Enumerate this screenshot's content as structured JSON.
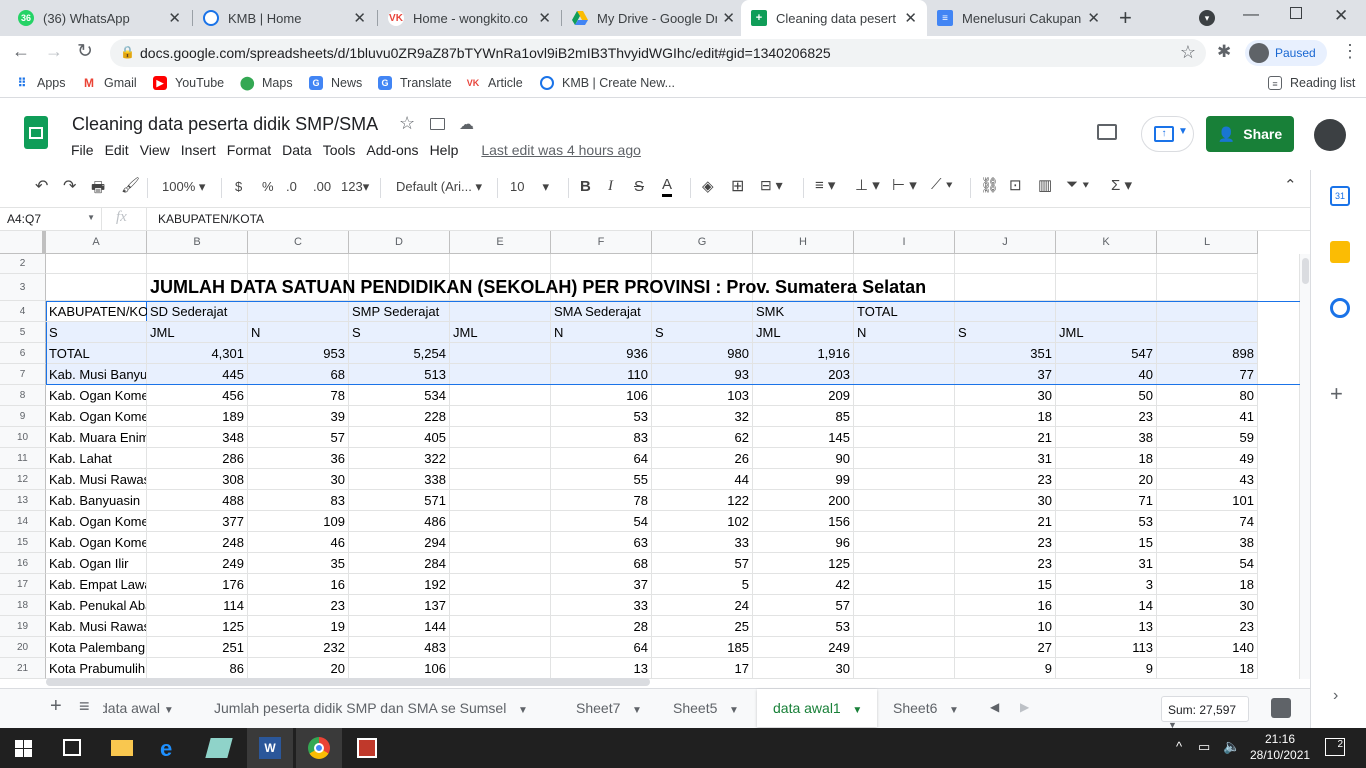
{
  "browser": {
    "tabs": [
      {
        "title": "(36) WhatsApp",
        "badge": "36",
        "color": "#25d366"
      },
      {
        "title": "KMB | Home",
        "color": "#1a73e8"
      },
      {
        "title": "Home - wongkito.co",
        "color": "#e8453c"
      },
      {
        "title": "My Drive - Google Dri",
        "color": "#fbbc04"
      },
      {
        "title": "Cleaning data peserta",
        "color": "#0f9d58"
      },
      {
        "title": "Menelusuri Cakupan V",
        "color": "#4285f4"
      }
    ],
    "url": "docs.google.com/spreadsheets/d/1bluvu0ZR9aZ87bTYWnRa1ovl9iB2mIB3ThvyidWGIhc/edit#gid=1340206825",
    "profile_label": "Paused",
    "bookmarks": [
      "Apps",
      "Gmail",
      "YouTube",
      "Maps",
      "News",
      "Translate",
      "Article",
      "KMB | Create New..."
    ],
    "reading_list": "Reading list"
  },
  "doc": {
    "title": "Cleaning data peserta didik SMP/SMA",
    "menus": [
      "File",
      "Edit",
      "View",
      "Insert",
      "Format",
      "Data",
      "Tools",
      "Add-ons",
      "Help"
    ],
    "last_edit": "Last edit was 4 hours ago",
    "share_label": "Share"
  },
  "toolbar": {
    "zoom": "100%",
    "currency": "$",
    "percent": "%",
    "dec_less": ".0",
    "dec_more": ".00",
    "format_more": "123",
    "font": "Default (Ari...",
    "font_size": "10"
  },
  "formula": {
    "namebox": "A4:Q7",
    "fx": "fx",
    "content": "KABUPATEN/KOTA"
  },
  "grid": {
    "columns": [
      "A",
      "B",
      "C",
      "D",
      "E",
      "F",
      "G",
      "H",
      "I",
      "J",
      "K",
      "L"
    ],
    "rownums": [
      "2",
      "3",
      "4",
      "5",
      "6",
      "7",
      "8",
      "9",
      "10",
      "11",
      "12",
      "13",
      "14",
      "15",
      "16",
      "17",
      "18",
      "19",
      "20",
      "21"
    ],
    "title": "JUMLAH DATA SATUAN PENDIDIKAN (SEKOLAH) PER PROVINSI : Prov. Sumatera Selatan",
    "row4": [
      "KABUPATEN/KOTA",
      "SD Sederajat",
      "",
      "SMP Sederajat",
      "",
      "SMA Sederajat",
      "",
      "SMK",
      "TOTAL",
      "",
      "",
      ""
    ],
    "row5": [
      "S",
      "JML",
      "N",
      "S",
      "JML",
      "N",
      "S",
      "JML",
      "N",
      "S",
      "JML",
      ""
    ],
    "data": [
      [
        "TOTAL",
        "4,301",
        "953",
        "5,254",
        "",
        "936",
        "980",
        "1,916",
        "",
        "351",
        "547",
        "898"
      ],
      [
        "Kab. Musi Banyuasin",
        "445",
        "68",
        "513",
        "",
        "110",
        "93",
        "203",
        "",
        "37",
        "40",
        "77"
      ],
      [
        "Kab. Ogan Komering Ulu",
        "456",
        "78",
        "534",
        "",
        "106",
        "103",
        "209",
        "",
        "30",
        "50",
        "80"
      ],
      [
        "Kab. Ogan Komering Ilir",
        "189",
        "39",
        "228",
        "",
        "53",
        "32",
        "85",
        "",
        "18",
        "23",
        "41"
      ],
      [
        "Kab. Muara Enim",
        "348",
        "57",
        "405",
        "",
        "83",
        "62",
        "145",
        "",
        "21",
        "38",
        "59"
      ],
      [
        "Kab. Lahat",
        "286",
        "36",
        "322",
        "",
        "64",
        "26",
        "90",
        "",
        "31",
        "18",
        "49"
      ],
      [
        "Kab. Musi Rawas",
        "308",
        "30",
        "338",
        "",
        "55",
        "44",
        "99",
        "",
        "23",
        "20",
        "43"
      ],
      [
        "Kab. Banyuasin",
        "488",
        "83",
        "571",
        "",
        "78",
        "122",
        "200",
        "",
        "30",
        "71",
        "101"
      ],
      [
        "Kab. Ogan Komering",
        "377",
        "109",
        "486",
        "",
        "54",
        "102",
        "156",
        "",
        "21",
        "53",
        "74"
      ],
      [
        "Kab. Ogan Komering",
        "248",
        "46",
        "294",
        "",
        "63",
        "33",
        "96",
        "",
        "23",
        "15",
        "38"
      ],
      [
        "Kab. Ogan Ilir",
        "249",
        "35",
        "284",
        "",
        "68",
        "57",
        "125",
        "",
        "23",
        "31",
        "54"
      ],
      [
        "Kab. Empat Lawang",
        "176",
        "16",
        "192",
        "",
        "37",
        "5",
        "42",
        "",
        "15",
        "3",
        "18"
      ],
      [
        "Kab. Penukal Abab",
        "114",
        "23",
        "137",
        "",
        "33",
        "24",
        "57",
        "",
        "16",
        "14",
        "30"
      ],
      [
        "Kab. Musi Rawas",
        "125",
        "19",
        "144",
        "",
        "28",
        "25",
        "53",
        "",
        "10",
        "13",
        "23"
      ],
      [
        "Kota Palembang",
        "251",
        "232",
        "483",
        "",
        "64",
        "185",
        "249",
        "",
        "27",
        "113",
        "140"
      ],
      [
        "Kota Prabumulih",
        "86",
        "20",
        "106",
        "",
        "13",
        "17",
        "30",
        "",
        "9",
        "9",
        "18"
      ]
    ]
  },
  "sheets": {
    "tabs": [
      "data awal",
      "Jumlah peserta didik SMP dan SMA se Sumsel",
      "Sheet7",
      "Sheet5",
      "data awal1",
      "Sheet6"
    ],
    "active": "data awal1",
    "sum": "Sum: 27,597"
  },
  "taskbar": {
    "time": "21:16",
    "date": "28/10/2021",
    "notif_count": "2"
  },
  "colors": {
    "sheets_green": "#0f9d58",
    "share_green": "#188038",
    "selection": "#e8f0fe",
    "link_blue": "#1a73e8"
  }
}
